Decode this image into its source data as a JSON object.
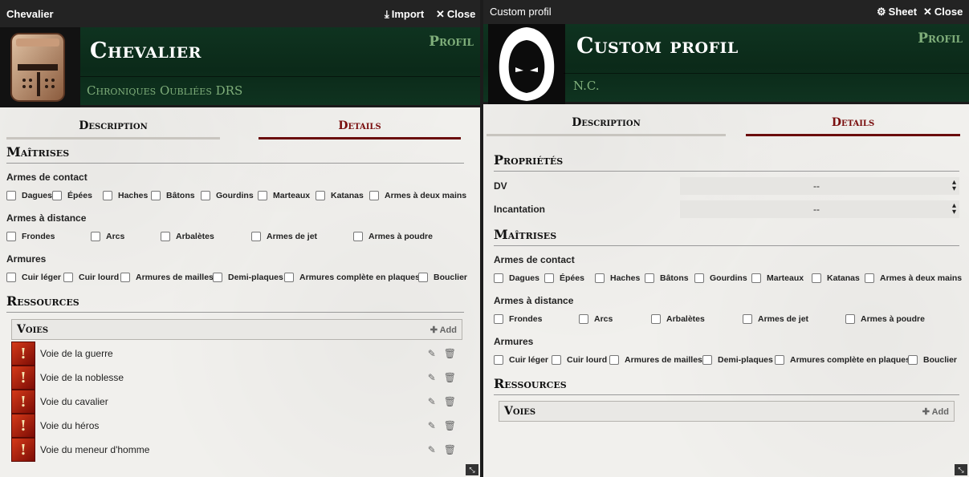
{
  "left": {
    "title": "Chevalier",
    "import_label": "Import",
    "close_label": "Close",
    "name": "Chevalier",
    "subtitle": "Chroniques Oubliées DRS",
    "type": "Profil",
    "tabs": [
      "Description",
      "Details"
    ],
    "maitrises_title": "Maîtrises",
    "contact_title": "Armes de contact",
    "contact": [
      "Dagues",
      "Épées",
      "Haches",
      "Bâtons",
      "Gourdins",
      "Marteaux",
      "Katanas",
      "Armes à deux mains"
    ],
    "distance_title": "Armes à distance",
    "distance": [
      "Frondes",
      "Arcs",
      "Arbalètes",
      "Armes de jet",
      "Armes à poudre"
    ],
    "armures_title": "Armures",
    "armures": [
      "Cuir léger",
      "Cuir lourd",
      "Armures de mailles",
      "Demi-plaques",
      "Armures complète en plaques",
      "Bouclier"
    ],
    "ressources_title": "Ressources",
    "voies_label": "Voies",
    "add_label": "Add",
    "voies": [
      "Voie de la guerre",
      "Voie de la noblesse",
      "Voie du cavalier",
      "Voie du héros",
      "Voie du meneur d'homme"
    ]
  },
  "right": {
    "title": "Custom profil",
    "sheet_label": "Sheet",
    "close_label": "Close",
    "name": "Custom profil",
    "subtitle": "N.C.",
    "type": "Profil",
    "tabs": [
      "Description",
      "Details"
    ],
    "proprietes_title": "Propriétés",
    "props": [
      {
        "label": "DV",
        "value": "--"
      },
      {
        "label": "Incantation",
        "value": "--"
      }
    ],
    "maitrises_title": "Maîtrises",
    "contact_title": "Armes de contact",
    "contact": [
      "Dagues",
      "Épées",
      "Haches",
      "Bâtons",
      "Gourdins",
      "Marteaux",
      "Katanas",
      "Armes à deux mains"
    ],
    "distance_title": "Armes à distance",
    "distance": [
      "Frondes",
      "Arcs",
      "Arbalètes",
      "Armes de jet",
      "Armes à poudre"
    ],
    "armures_title": "Armures",
    "armures": [
      "Cuir léger",
      "Cuir lourd",
      "Armures de mailles",
      "Demi-plaques",
      "Armures complète en plaques",
      "Bouclier"
    ],
    "ressources_title": "Ressources",
    "voies_label": "Voies",
    "add_label": "Add"
  },
  "colors": {
    "banner_green": "#0f3320",
    "accent_green": "#7fae7a",
    "tab_red": "#7a0f0f"
  }
}
